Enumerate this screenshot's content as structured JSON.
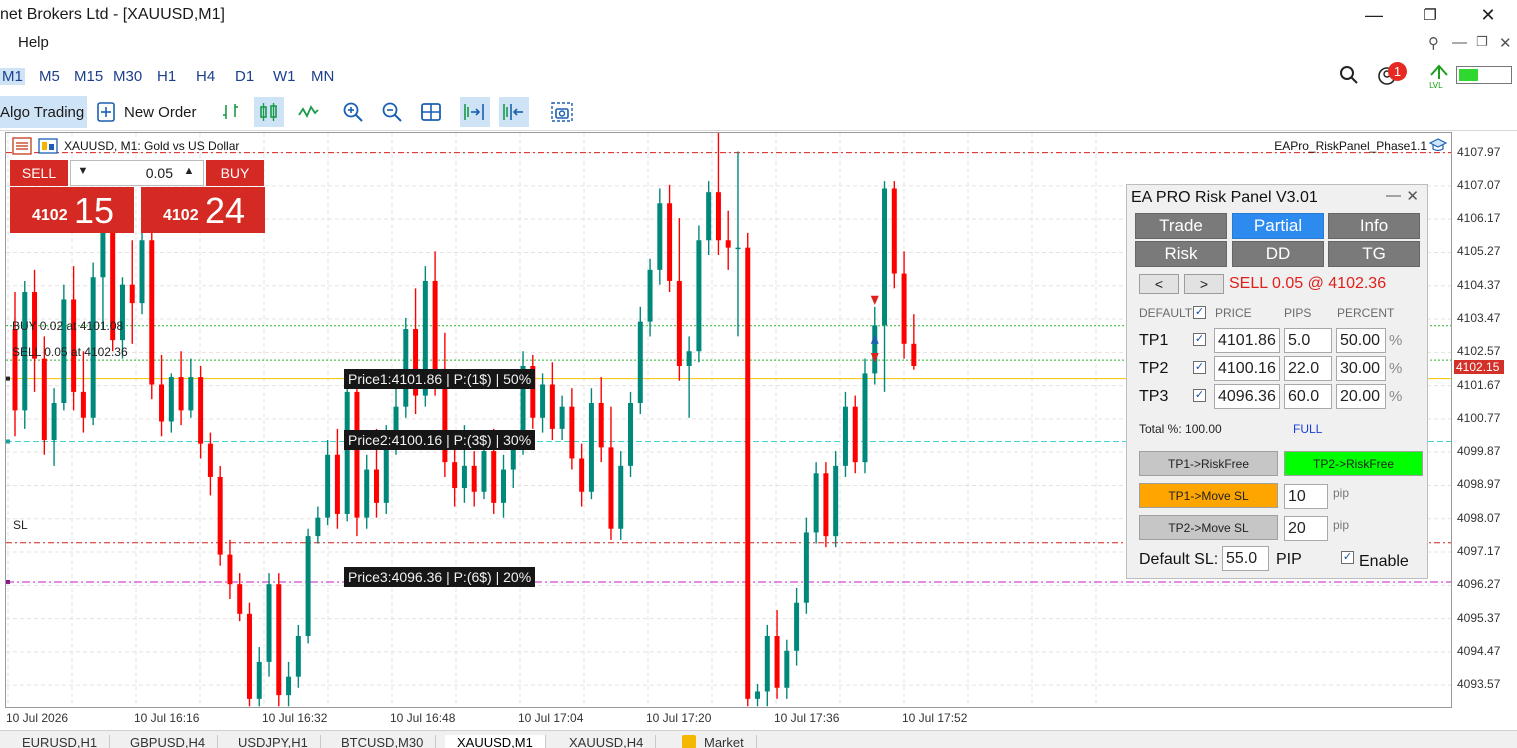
{
  "window": {
    "title": "net Brokers Ltd - [XAUUSD,M1]",
    "minimize": "—",
    "maximize": "❐",
    "close": "✕"
  },
  "menu": {
    "help": "Help",
    "mdi_pin": "⚲",
    "mdi_min": "—",
    "mdi_restore": "❐",
    "mdi_close": "✕"
  },
  "timeframes": [
    "M1",
    "M5",
    "M15",
    "M30",
    "H1",
    "H4",
    "D1",
    "W1",
    "MN"
  ],
  "active_timeframe": "M1",
  "notification_count": "1",
  "toolbar": {
    "algo_trading": "Algo Trading",
    "new_order": "New Order"
  },
  "chart": {
    "title": "XAUUSD, M1:  Gold vs US Dollar",
    "ea_name": "EAPro_RiskPanel_Phase1.1",
    "buy_line_label": "BUY 0.02 at 4101.08",
    "sell_line_label": "SELL 0.05 at 4102.36",
    "sl_label": "SL",
    "tp_labels": [
      "Price1:4101.86 | P:(1$) | 50%",
      "Price2:4100.16 | P:(3$) | 30%",
      "Price3:4096.36 | P:(6$) | 20%"
    ],
    "current_price": "4102.15",
    "price_ticks": [
      "4107.97",
      "4107.07",
      "4106.17",
      "4105.27",
      "4104.37",
      "4103.47",
      "4102.57",
      "4101.67",
      "4100.77",
      "4099.87",
      "4098.97",
      "4098.07",
      "4097.17",
      "4096.27",
      "4095.37",
      "4094.47",
      "4093.57"
    ],
    "time_ticks": [
      "10 Jul 2026",
      "10 Jul 16:16",
      "10 Jul 16:32",
      "10 Jul 16:48",
      "10 Jul 17:04",
      "10 Jul 17:20",
      "10 Jul 17:36",
      "10 Jul 17:52"
    ],
    "colors": {
      "bull": "#00897b",
      "bear": "#ff0000",
      "grid": "#e3e3e3",
      "sell_line": "#e0201b",
      "buy_line": "#2bb52b",
      "tp1_line": "#f2c200",
      "tp2_line": "#3fd4d4",
      "tp3_line": "#c71bc7",
      "sl_line": "#d0201b"
    }
  },
  "chart_data": {
    "type": "candlestick",
    "symbol": "XAUUSD",
    "timeframe": "M1",
    "ylim": [
      4093.0,
      4108.5
    ],
    "grid": true,
    "candles": [
      [
        4103.2,
        4104.2,
        4100.3,
        4101.0
      ],
      [
        4101.0,
        4104.5,
        4100.5,
        4104.2
      ],
      [
        4104.2,
        4104.8,
        4101.5,
        4102.4
      ],
      [
        4102.4,
        4103.0,
        4099.8,
        4100.2
      ],
      [
        4100.2,
        4101.6,
        4099.5,
        4101.2
      ],
      [
        4101.2,
        4104.4,
        4101.0,
        4104.0
      ],
      [
        4104.0,
        4104.9,
        4101.0,
        4101.5
      ],
      [
        4101.5,
        4102.6,
        4100.4,
        4100.8
      ],
      [
        4100.8,
        4105.0,
        4100.6,
        4104.6
      ],
      [
        4104.6,
        4105.9,
        4103.2,
        4105.8
      ],
      [
        4105.8,
        4106.0,
        4102.6,
        4102.9
      ],
      [
        4102.9,
        4104.6,
        4102.4,
        4104.4
      ],
      [
        4104.4,
        4105.6,
        4102.8,
        4103.9
      ],
      [
        4103.9,
        4105.9,
        4103.6,
        4105.6
      ],
      [
        4105.6,
        4106.0,
        4101.3,
        4101.7
      ],
      [
        4101.7,
        4102.5,
        4100.3,
        4100.7
      ],
      [
        4100.7,
        4102.0,
        4100.4,
        4101.9
      ],
      [
        4101.9,
        4102.6,
        4100.6,
        4101.0
      ],
      [
        4101.0,
        4102.4,
        4100.8,
        4101.9
      ],
      [
        4101.9,
        4102.2,
        4099.7,
        4100.1
      ],
      [
        4100.1,
        4100.4,
        4098.7,
        4099.2
      ],
      [
        4099.2,
        4099.5,
        4096.8,
        4097.1
      ],
      [
        4097.1,
        4097.5,
        4095.9,
        4096.3
      ],
      [
        4096.3,
        4096.6,
        4095.3,
        4095.5
      ],
      [
        4095.5,
        4095.8,
        4093.0,
        4093.2
      ],
      [
        4093.2,
        4094.6,
        4093.0,
        4094.2
      ],
      [
        4094.2,
        4096.6,
        4093.8,
        4096.3
      ],
      [
        4096.3,
        4096.6,
        4093.0,
        4093.3
      ],
      [
        4093.3,
        4094.2,
        4093.0,
        4093.8
      ],
      [
        4093.8,
        4095.2,
        4093.5,
        4094.9
      ],
      [
        4094.9,
        4097.8,
        4094.7,
        4097.6
      ],
      [
        4097.6,
        4098.4,
        4097.4,
        4098.1
      ],
      [
        4098.1,
        4100.2,
        4097.9,
        4099.8
      ],
      [
        4099.8,
        4100.5,
        4097.8,
        4098.2
      ],
      [
        4098.2,
        4101.9,
        4098.0,
        4101.5
      ],
      [
        4101.5,
        4102.0,
        4097.6,
        4098.1
      ],
      [
        4098.1,
        4099.8,
        4097.8,
        4099.4
      ],
      [
        4099.4,
        4100.5,
        4098.1,
        4098.5
      ],
      [
        4098.5,
        4100.6,
        4098.2,
        4100.2
      ],
      [
        4100.2,
        4101.6,
        4099.8,
        4101.1
      ],
      [
        4101.1,
        4103.5,
        4100.8,
        4103.2
      ],
      [
        4103.2,
        4104.3,
        4100.9,
        4101.4
      ],
      [
        4101.4,
        4104.9,
        4101.1,
        4104.5
      ],
      [
        4104.5,
        4105.3,
        4101.4,
        4101.7
      ],
      [
        4101.7,
        4103.1,
        4099.2,
        4099.6
      ],
      [
        4099.6,
        4100.3,
        4098.4,
        4098.9
      ],
      [
        4098.9,
        4100.6,
        4098.5,
        4099.5
      ],
      [
        4099.5,
        4099.9,
        4098.4,
        4098.8
      ],
      [
        4098.8,
        4100.2,
        4098.6,
        4099.9
      ],
      [
        4099.9,
        4100.5,
        4098.2,
        4098.5
      ],
      [
        4098.5,
        4099.8,
        4098.1,
        4099.4
      ],
      [
        4099.4,
        4100.3,
        4098.9,
        4100.1
      ],
      [
        4100.1,
        4102.6,
        4099.8,
        4102.2
      ],
      [
        4102.2,
        4102.5,
        4100.5,
        4100.8
      ],
      [
        4100.8,
        4102.0,
        4100.4,
        4101.7
      ],
      [
        4101.7,
        4102.3,
        4100.2,
        4100.5
      ],
      [
        4100.5,
        4101.4,
        4100.2,
        4101.1
      ],
      [
        4101.1,
        4101.6,
        4099.4,
        4099.7
      ],
      [
        4099.7,
        4100.1,
        4098.4,
        4098.8
      ],
      [
        4098.8,
        4101.6,
        4098.6,
        4101.2
      ],
      [
        4101.2,
        4101.9,
        4099.6,
        4100.0
      ],
      [
        4100.0,
        4101.1,
        4097.5,
        4097.8
      ],
      [
        4097.8,
        4099.9,
        4097.5,
        4099.5
      ],
      [
        4099.5,
        4101.5,
        4099.2,
        4101.2
      ],
      [
        4101.2,
        4103.8,
        4100.9,
        4103.4
      ],
      [
        4103.4,
        4105.1,
        4103.0,
        4104.8
      ],
      [
        4104.8,
        4107.0,
        4104.4,
        4106.6
      ],
      [
        4106.6,
        4107.1,
        4104.2,
        4104.5
      ],
      [
        4104.5,
        4106.2,
        4101.8,
        4102.2
      ],
      [
        4102.2,
        4103.0,
        4100.8,
        4102.6
      ],
      [
        4102.6,
        4106.0,
        4102.3,
        4105.6
      ],
      [
        4105.6,
        4107.2,
        4105.2,
        4106.9
      ],
      [
        4106.9,
        4108.5,
        4105.2,
        4105.6
      ],
      [
        4105.6,
        4106.4,
        4104.8,
        4105.4
      ],
      [
        4105.4,
        4108.0,
        4103.0,
        4105.4
      ],
      [
        4105.4,
        4105.8,
        4093.0,
        4093.2
      ],
      [
        4093.2,
        4093.6,
        4093.0,
        4093.4
      ],
      [
        4093.4,
        4095.2,
        4093.0,
        4094.9
      ],
      [
        4094.9,
        4095.6,
        4093.2,
        4093.5
      ],
      [
        4093.5,
        4094.8,
        4093.2,
        4094.5
      ],
      [
        4094.5,
        4096.2,
        4094.1,
        4095.8
      ],
      [
        4095.8,
        4098.1,
        4095.5,
        4097.7
      ],
      [
        4097.7,
        4099.6,
        4097.4,
        4099.3
      ],
      [
        4099.3,
        4099.6,
        4097.3,
        4097.6
      ],
      [
        4097.6,
        4099.9,
        4097.3,
        4099.5
      ],
      [
        4099.5,
        4101.5,
        4099.2,
        4101.1
      ],
      [
        4101.1,
        4101.4,
        4099.3,
        4099.6
      ],
      [
        4099.6,
        4102.4,
        4099.3,
        4102.0
      ],
      [
        4102.0,
        4103.8,
        4101.7,
        4103.3
      ],
      [
        4103.3,
        4107.2,
        4101.5,
        4107.0
      ],
      [
        4107.0,
        4107.2,
        4104.3,
        4104.7
      ],
      [
        4104.7,
        4105.3,
        4102.4,
        4102.8
      ],
      [
        4102.8,
        4103.6,
        4102.1,
        4102.2
      ]
    ]
  },
  "one_click": {
    "sell_label": "SELL",
    "buy_label": "BUY",
    "lot": "0.05",
    "bid_big_prefix": "4102",
    "bid_pips": "15",
    "ask_big_prefix": "4102",
    "ask_pips": "24"
  },
  "panel": {
    "title": "EA PRO Risk Panel V3.01",
    "min": "—",
    "close": "✕",
    "tabs_row1": [
      "Trade",
      "Partial",
      "Info"
    ],
    "tabs_row2": [
      "Risk",
      "DD",
      "TG"
    ],
    "active_tab": "Partial",
    "prev": "<",
    "next": ">",
    "position_text": "SELL 0.05 @ 4102.36",
    "col_default": "DEFAULT",
    "col_price": "PRICE",
    "col_pips": "PIPS",
    "col_percent": "PERCENT",
    "check": "✓",
    "rows": [
      {
        "label": "TP1",
        "price": "4101.86",
        "pips": "5.0",
        "percent": "50.00"
      },
      {
        "label": "TP2",
        "price": "4100.16",
        "pips": "22.0",
        "percent": "30.00"
      },
      {
        "label": "TP3",
        "price": "4096.36",
        "pips": "60.0",
        "percent": "20.00"
      }
    ],
    "pct_sign": "%",
    "total_text": "Total %: 100.00",
    "full_text": "FULL",
    "btn_tp1_riskfree": "TP1->RiskFree",
    "btn_tp2_riskfree": "TP2->RiskFree",
    "btn_tp1_movesl": "TP1->Move SL",
    "btn_tp2_movesl": "TP2->Move SL",
    "tp1_movesl_pips": "10",
    "tp2_movesl_pips": "20",
    "pip_text": "pip",
    "default_sl_label": "Default SL:",
    "default_sl_value": "55.0",
    "pip_unit": "PIP",
    "enable_label": "Enable",
    "colors": {
      "tab": "#7a7a7a",
      "tab_active": "#2d8bf0",
      "green": "#00ff00",
      "orange": "#ffa500",
      "grey_btn": "#c6c6c6"
    }
  },
  "chart_tabs": [
    "EURUSD,H1",
    "GBPUSD,H4",
    "USDJPY,H1",
    "BTCUSD,M30",
    "XAUUSD,M1",
    "XAUUSD,H4",
    "Market"
  ],
  "active_chart_tab": "XAUUSD,M1"
}
